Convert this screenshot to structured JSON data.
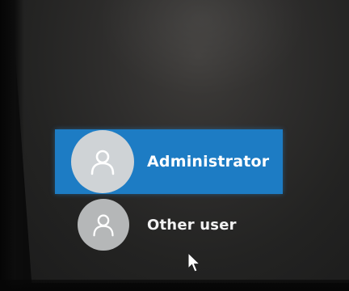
{
  "users": [
    {
      "name": "Administrator",
      "selected": true,
      "icon": "user-icon"
    },
    {
      "name": "Other user",
      "selected": false,
      "icon": "user-icon"
    }
  ],
  "colors": {
    "selected_tile": "#1d7cc4",
    "avatar_selected": "#cfd3d6",
    "avatar_plain": "#b5b7b8",
    "text": "#ffffff"
  },
  "cursor": {
    "icon": "mouse-pointer-icon"
  }
}
